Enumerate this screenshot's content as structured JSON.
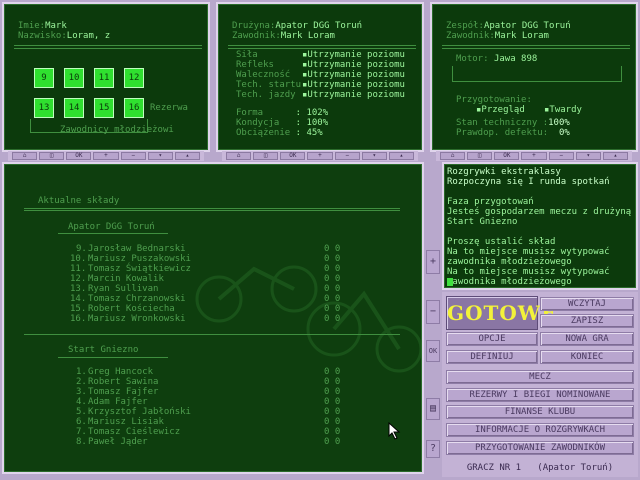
{
  "panel1": {
    "imie_label": "Imie:",
    "imie_value": "Mark",
    "nazwisko_label": "Nazwisko:",
    "nazwisko_value": "Loram, z",
    "slots_top": [
      "9",
      "10",
      "11",
      "12"
    ],
    "slots_bottom": [
      "13",
      "14",
      "15",
      "16"
    ],
    "rezerwa": "Rezerwa",
    "zawodnicy_mlodziezowi": "Zawodnicy młodzieżowi"
  },
  "panel2": {
    "druzyna_label": "Drużyna:",
    "druzyna_value": "Apator DGG Toruń",
    "zawodnik_label": "Zawodnik:",
    "zawodnik_value": "Mark Loram",
    "stats": [
      {
        "label": "Siła",
        "value": "Utrzymanie poziomu"
      },
      {
        "label": "Refleks",
        "value": "Utrzymanie poziomu"
      },
      {
        "label": "Waleczność",
        "value": "Utrzymanie poziomu"
      },
      {
        "label": "Tech. startu",
        "value": "Utrzymanie poziomu"
      },
      {
        "label": "Tech. jazdy",
        "value": "Utrzymanie poziomu"
      }
    ],
    "forma_label": "Forma",
    "forma_value": ": 102%",
    "kondycja_label": "Kondycja",
    "kondycja_value": ": 100%",
    "obciazenie_label": "Obciążenie",
    "obciazenie_value": ": 45%"
  },
  "panel3": {
    "zespol_label": "Zespół:",
    "zespol_value": "Apator DGG Toruń",
    "zawodnik_label": "Zawodnik:",
    "zawodnik_value": "Mark Loram",
    "motor_label": "Motor:",
    "motor_value": "Jawa 898",
    "przygotowanie_label": "Przygotowanie:",
    "przeglad": "Przegląd",
    "twardy": "Twardy",
    "stan_label": "Stan techniczny :",
    "stan_value": "100%",
    "prawdop_label": "Prawdop. defektu:",
    "prawdop_value": "0%"
  },
  "toolbar": [
    "⌂",
    "◫",
    "OK",
    "+",
    "−",
    "▾",
    "▴"
  ],
  "main": {
    "title": "Aktualne składy",
    "team1": "Apator DGG Toruń",
    "team1_riders": [
      {
        "no": "9.",
        "name": "Jarosław Bednarski",
        "s": "0 0"
      },
      {
        "no": "10.",
        "name": "Mariusz Puszakowski",
        "s": "0 0"
      },
      {
        "no": "11.",
        "name": "Tomasz Świątkiewicz",
        "s": "0 0"
      },
      {
        "no": "12.",
        "name": "Marcin Kowalik",
        "s": "0 0"
      },
      {
        "no": "13.",
        "name": "Ryan Sullivan",
        "s": "0 0"
      },
      {
        "no": "14.",
        "name": "Tomasz Chrzanowski",
        "s": "0 0"
      },
      {
        "no": "15.",
        "name": "Robert Kościecha",
        "s": "0 0"
      },
      {
        "no": "16.",
        "name": "Mariusz Wronkowski",
        "s": "0 0"
      }
    ],
    "team2": "Start Gniezno",
    "team2_riders": [
      {
        "no": "1.",
        "name": "Greg Hancock",
        "s": "0 0"
      },
      {
        "no": "2.",
        "name": "Robert Sawina",
        "s": "0 0"
      },
      {
        "no": "3.",
        "name": "Tomasz Fajfer",
        "s": "0 0"
      },
      {
        "no": "4.",
        "name": "Adam Fajfer",
        "s": "0 0"
      },
      {
        "no": "5.",
        "name": "Krzysztof Jabłoński",
        "s": "0 0"
      },
      {
        "no": "6.",
        "name": "Mariusz Lisiak",
        "s": "0 0"
      },
      {
        "no": "7.",
        "name": "Tomasz Cieślewicz",
        "s": "0 0"
      },
      {
        "no": "8.",
        "name": "Paweł Jąder",
        "s": "0 0"
      }
    ]
  },
  "sidebar": [
    "+",
    "−",
    "OK",
    "▤",
    "?"
  ],
  "messages": [
    "Rozgrywki ekstraklasy",
    "Rozpoczyna się I runda spotkań",
    "",
    "Faza przygotowań",
    "Jesteś gospodarzem meczu z drużyną",
    "Start Gniezno",
    "",
    "Proszę ustalić skład",
    "Na to miejsce musisz wytypować",
    "zawodnika młodzieżowego",
    "Na to miejsce musisz wytypować",
    "zawodnika młodzieżowego"
  ],
  "buttons": {
    "gotowe": "GOTOWE",
    "wczytaj": "WCZYTAJ",
    "zapisz": "ZAPISZ",
    "opcje": "OPCJE",
    "nowa_gra": "NOWA GRA",
    "definiuj": "DEFINIUJ",
    "koniec": "KONIEC",
    "mecz": "MECZ",
    "rezerwy": "REZERWY I BIEGI NOMINOWANE",
    "finanse": "FINANSE KLUBU",
    "informacje": "INFORMACJE O ROZGRYWKACH",
    "przygotowanie": "PRZYGOTOWANIE ZAWODNIKÓW"
  },
  "status": "GRACZ NR 1   (Apator Toruń)"
}
